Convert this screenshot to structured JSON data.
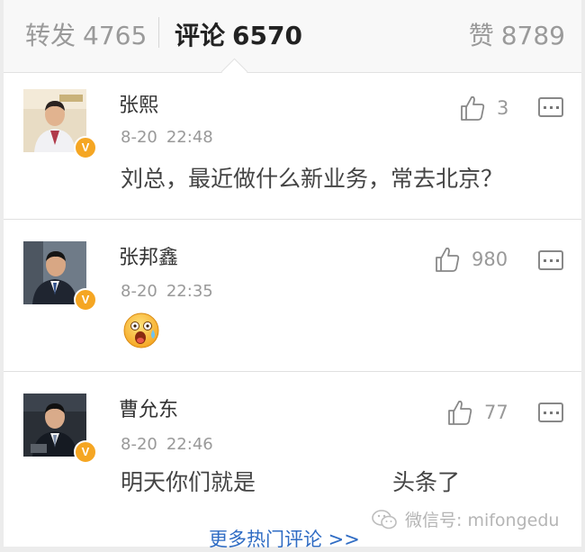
{
  "tabs": {
    "repost_label": "转发",
    "repost_count": "4765",
    "comment_label": "评论",
    "comment_count": "6570",
    "like_label": "赞",
    "like_count": "8789"
  },
  "comments": [
    {
      "username": "张熙",
      "date": "8-20",
      "time": "22:48",
      "likes": "3",
      "text": "刘总，最近做什么新业务，常去北京？",
      "verified": "V"
    },
    {
      "username": "张邦鑫",
      "date": "8-20",
      "time": "22:35",
      "likes": "980",
      "text": "",
      "emoji": "shocked-face-emoji",
      "verified": "V"
    },
    {
      "username": "曹允东",
      "date": "8-20",
      "time": "22:46",
      "likes": "77",
      "text_part1": "明天你们就是",
      "text_part2": "头条了",
      "verified": "V"
    }
  ],
  "footer": {
    "more_label": "更多热门评论 >>",
    "watermark": "微信号: mifongedu"
  },
  "colors": {
    "link": "#2f6cc4",
    "badge": "#f5a623",
    "muted": "#999999"
  }
}
